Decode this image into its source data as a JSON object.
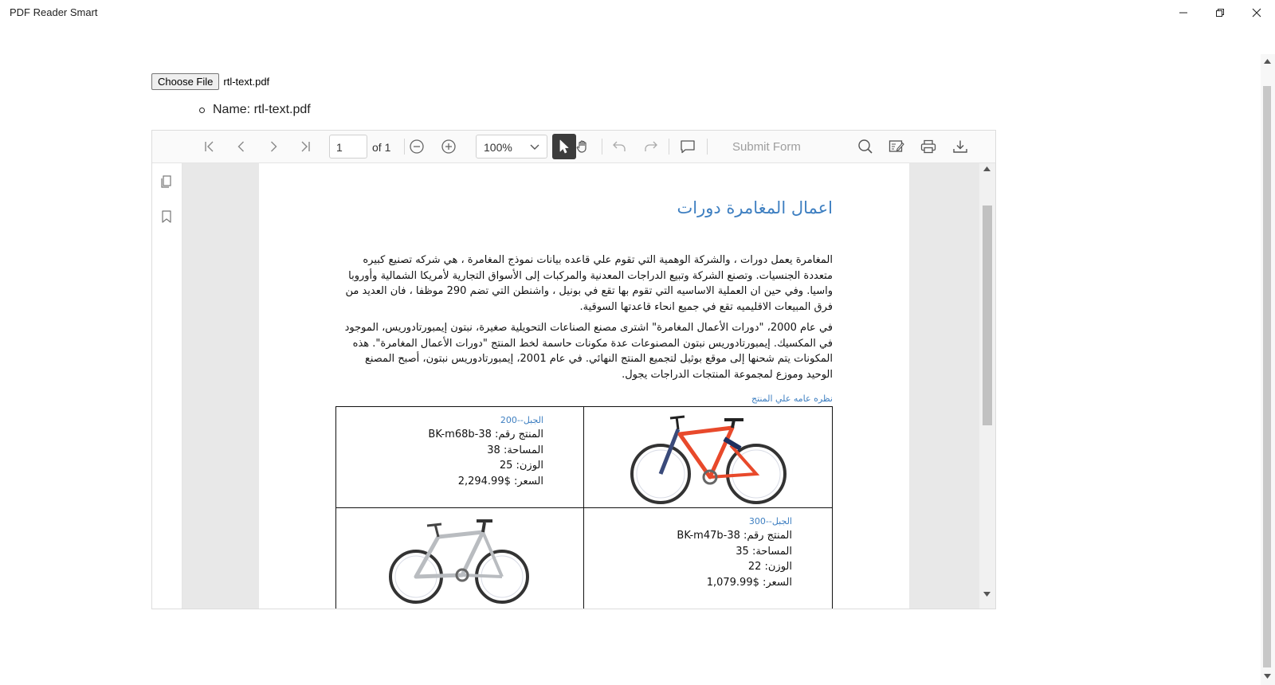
{
  "window": {
    "title": "PDF Reader Smart"
  },
  "file_input": {
    "button_label": "Choose File",
    "file_name": "rtl-text.pdf",
    "name_line": "Name: rtl-text.pdf"
  },
  "toolbar": {
    "page_current": "1",
    "page_total": "of 1",
    "zoom": "100%",
    "submit_form": "Submit Form"
  },
  "document": {
    "title": "اعمال المغامرة دورات",
    "paragraph_1": "المغامرة يعمل دورات ، والشركة الوهمية التي تقوم علي قاعده بيانات نموذج المغامرة ، هي شركه تصنيع كبيره متعددة الجنسيات. وتصنع الشركة وتبيع الدراجات المعدنية والمركبات إلى الأسواق التجارية لأمريكا الشمالية وأوروبا واسيا. وفي حين ان العملية الاساسيه التي تقوم بها تقع في بونيل ، واشنطن التي تضم 290 موظفا ، فان العديد من فرق المبيعات الاقليميه تقع في جميع انحاء قاعدتها السوقية.",
    "paragraph_2": "في عام 2000، \"دورات الأعمال المغامرة\" اشترى مصنع الصناعات التحويلية صغيرة، نبتون إيمبورتادوريس، الموجود في المكسيك. إيمبورتادوريس نبتون المصنوعات عدة مكونات حاسمة لخط المنتج \"دورات الأعمال المغامرة\". هذه المكونات يتم شحنها إلى موقع بوثيل لتجميع المنتج النهائي. في عام 2001، إيمبورتادوريس نبتون، أصبح المصنع الوحيد وموزع لمجموعة المنتجات الدراجات يجول.",
    "section_label": "نظره عامه علي المنتج",
    "products": [
      {
        "name": "الجبل--200",
        "number": "المنتج رقم: BK-m68b-38",
        "size": "المساحة: 38",
        "weight": "الوزن: 25",
        "price": "السعر: $2,294.99"
      },
      {
        "name": "الجبل--300",
        "number": "المنتج رقم: BK-m47b-38",
        "size": "المساحة: 35",
        "weight": "الوزن: 22",
        "price": "السعر: $1,079.99"
      }
    ]
  },
  "colors": {
    "accent": "#3e7fc1",
    "bike_red": "#e8492b",
    "bike_silver": "#b9bcc0"
  },
  "icons": [
    "minimize-icon",
    "restore-icon",
    "close-icon",
    "first-page-icon",
    "prev-page-icon",
    "next-page-icon",
    "last-page-icon",
    "zoom-out-icon",
    "zoom-in-icon",
    "chevron-down-icon",
    "select-tool-icon",
    "pan-tool-icon",
    "undo-icon",
    "redo-icon",
    "comment-icon",
    "search-icon",
    "annotate-icon",
    "print-icon",
    "download-icon",
    "page-thumbnails-icon",
    "bookmark-icon"
  ]
}
